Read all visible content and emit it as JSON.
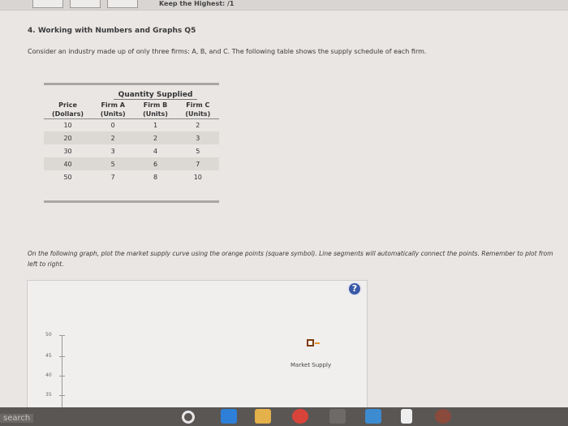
{
  "header": {
    "keep_label": "Keep the Highest: /1"
  },
  "question": {
    "heading": "4. Working with Numbers and Graphs Q5",
    "intro": "Consider an industry made up of only three firms: A, B, and C. The following table shows the supply schedule of each firm."
  },
  "table": {
    "group_header": "Quantity Supplied",
    "headers": [
      "Price",
      "Firm A",
      "Firm B",
      "Firm C"
    ],
    "units": [
      "(Dollars)",
      "(Units)",
      "(Units)",
      "(Units)"
    ],
    "rows": [
      [
        "10",
        "0",
        "1",
        "2"
      ],
      [
        "20",
        "2",
        "2",
        "3"
      ],
      [
        "30",
        "3",
        "4",
        "5"
      ],
      [
        "40",
        "5",
        "6",
        "7"
      ],
      [
        "50",
        "7",
        "8",
        "10"
      ]
    ]
  },
  "instructions": "On the following graph, plot the market supply curve using the orange points (square symbol). Line segments will automatically connect the points. Remember to plot from left to right.",
  "graph": {
    "help_label": "?",
    "y_ticks": [
      "50",
      "45",
      "40",
      "35"
    ],
    "legend_label": "Market Supply",
    "point_color": "#e8942c"
  },
  "taskbar": {
    "search_label": "search"
  }
}
